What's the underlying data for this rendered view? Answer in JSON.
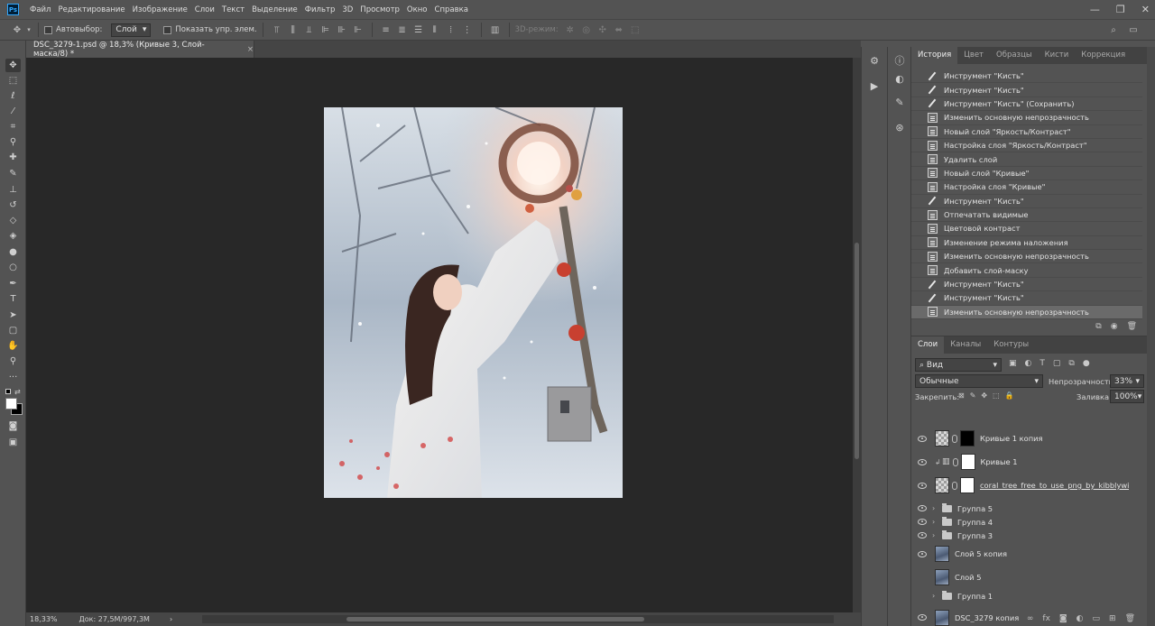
{
  "app": {
    "logo": "Ps"
  },
  "menu": [
    "Файл",
    "Редактирование",
    "Изображение",
    "Слои",
    "Текст",
    "Выделение",
    "Фильтр",
    "3D",
    "Просмотр",
    "Окно",
    "Справка"
  ],
  "window_controls": {
    "minimize": "—",
    "restore": "❐",
    "close": "✕"
  },
  "options": {
    "autoselect_label": "Автовыбор:",
    "autoselect_value": "Слой",
    "show_transform_label": "Показать упр. элем.",
    "mode_3d_label": "3D-режим:"
  },
  "document": {
    "tab_title": "DSC_3279-1.psd @ 18,3% (Кривые 3, Слой-маска/8) *",
    "close": "×"
  },
  "status": {
    "zoom": "18,33%",
    "doc_size": "Док: 27,5M/997,3M",
    "arrow": "›"
  },
  "tool_icons": [
    "move-icon",
    "marquee-icon",
    "lasso-icon",
    "magic-wand-icon",
    "crop-icon",
    "eyedropper-icon",
    "healing-icon",
    "brush-icon",
    "stamp-icon",
    "history-brush-icon",
    "eraser-icon",
    "gradient-icon",
    "blur-icon",
    "dodge-icon",
    "pen-icon",
    "type-icon",
    "path-select-icon",
    "shape-icon",
    "hand-icon",
    "zoom-icon",
    "more-icon"
  ],
  "history_panel": {
    "tabs": [
      "История",
      "Цвет",
      "Образцы",
      "Кисти",
      "Коррекция"
    ],
    "active_tab": 0,
    "items": [
      {
        "icon": "brush",
        "label": "Инструмент \"Кисть\""
      },
      {
        "icon": "brush",
        "label": "Инструмент \"Кисть\""
      },
      {
        "icon": "brush",
        "label": "Инструмент \"Кисть\" (Сохранить)"
      },
      {
        "icon": "doc",
        "label": "Изменить основную непрозрачность"
      },
      {
        "icon": "doc",
        "label": "Новый слой \"Яркость/Контраст\""
      },
      {
        "icon": "doc",
        "label": "Настройка слоя \"Яркость/Контраст\""
      },
      {
        "icon": "doc",
        "label": "Удалить слой"
      },
      {
        "icon": "doc",
        "label": "Новый слой \"Кривые\""
      },
      {
        "icon": "doc",
        "label": "Настройка слоя \"Кривые\""
      },
      {
        "icon": "brush",
        "label": "Инструмент \"Кисть\""
      },
      {
        "icon": "doc",
        "label": "Отпечатать видимые"
      },
      {
        "icon": "doc",
        "label": "Цветовой контраст"
      },
      {
        "icon": "doc",
        "label": "Изменение режима наложения"
      },
      {
        "icon": "doc",
        "label": "Изменить основную непрозрачность"
      },
      {
        "icon": "doc",
        "label": "Добавить слой-маску"
      },
      {
        "icon": "brush",
        "label": "Инструмент \"Кисть\""
      },
      {
        "icon": "brush",
        "label": "Инструмент \"Кисть\""
      },
      {
        "icon": "doc",
        "label": "Изменить основную непрозрачность"
      }
    ],
    "selected_index": 17
  },
  "layers_panel": {
    "tabs": [
      "Слои",
      "Каналы",
      "Контуры"
    ],
    "active_tab": 0,
    "filter_label": "Вид",
    "blend_mode": "Обычные",
    "opacity_label": "Непрозрачность:",
    "opacity_value": "33%",
    "lock_label": "Закрепить:",
    "fill_label": "Заливка:",
    "fill_value": "100%",
    "layers": [
      {
        "name": "Кривые 1 копия",
        "type": "adj-mask",
        "visible": true
      },
      {
        "name": "Кривые 1",
        "type": "adj",
        "visible": true
      },
      {
        "name": "coral_tree_free_to_use_png_by_kibblywib...",
        "type": "smart",
        "visible": true
      },
      {
        "name": "Группа 5",
        "type": "group",
        "visible": true
      },
      {
        "name": "Группа 4",
        "type": "group",
        "visible": true
      },
      {
        "name": "Группа 3",
        "type": "group",
        "visible": true
      },
      {
        "name": "Слой 5 копия",
        "type": "image",
        "visible": true
      },
      {
        "name": "Слой 5",
        "type": "image",
        "visible": false
      },
      {
        "name": "Группа 1",
        "type": "group",
        "visible": false
      },
      {
        "name": "DSC_3279 копия",
        "type": "image",
        "visible": true
      }
    ]
  }
}
